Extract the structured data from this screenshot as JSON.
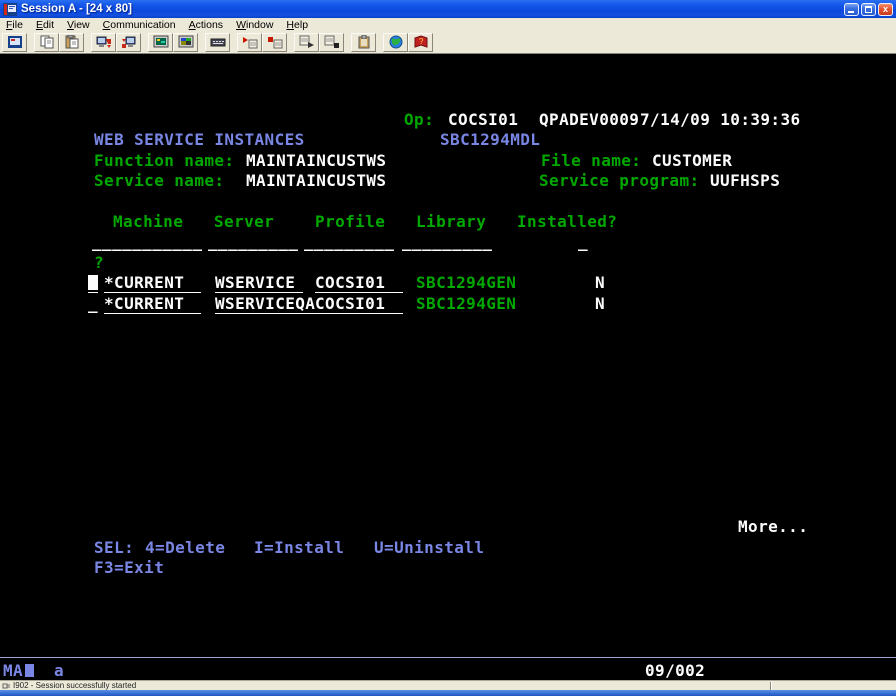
{
  "window": {
    "title": "Session A - [24 x 80]"
  },
  "menu": {
    "items": [
      {
        "accel": "F",
        "rest": "ile"
      },
      {
        "accel": "E",
        "rest": "dit"
      },
      {
        "accel": "V",
        "rest": "iew"
      },
      {
        "accel": "C",
        "rest": "ommunication"
      },
      {
        "accel": "A",
        "rest": "ctions"
      },
      {
        "accel": "W",
        "rest": "indow"
      },
      {
        "accel": "H",
        "rest": "elp"
      }
    ]
  },
  "toolbar": {
    "icons": [
      "new-session",
      "copy",
      "paste",
      "send-file",
      "receive-file",
      "display-setup",
      "color-setup",
      "keyboard-setup",
      "record-macro",
      "stop-macro",
      "play-macro",
      "step-macro",
      "clipboard",
      "web-browser",
      "help"
    ]
  },
  "terminal": {
    "colors": {
      "green": "#00a800",
      "blue": "#7a86e4",
      "white": "#fcfcfc",
      "background": "#000000"
    },
    "op_label": "Op:",
    "op_value": "COCSI01",
    "device": "QPADEV0009",
    "datetime": "7/14/09 10:39:36",
    "screen_title": "WEB SERVICE INSTANCES",
    "model": "SBC1294MDL",
    "function_label": "Function name:",
    "function_value": "MAINTAINCUSTWS",
    "file_label": "File name:",
    "file_value": "CUSTOMER",
    "service_label": "Service name:",
    "service_value": "MAINTAINCUSTWS",
    "service_program_label": "Service program:",
    "service_program_value": "UUFHSPS",
    "columns": [
      "Machine",
      "Server",
      "Profile",
      "Library",
      "Installed?"
    ],
    "underscores": {
      "c1": "___________",
      "c2": "_________",
      "c3": "_________",
      "c4": "_________",
      "c5": "_"
    },
    "prompt": "?",
    "rows": [
      {
        "sel": "",
        "machine": "*CURRENT",
        "server": "WSERVICE",
        "profile": "COCSI01",
        "library": "SBC1294GEN",
        "installed": "N"
      },
      {
        "sel": "_",
        "machine": "*CURRENT",
        "server": "WSERVICEQA",
        "profile": "COCSI01",
        "library": "SBC1294GEN",
        "installed": "N"
      }
    ],
    "more": "More...",
    "sel_label": "SEL:",
    "sel_options": [
      "4=Delete",
      "I=Install",
      "U=Uninstall"
    ],
    "fkeys": "F3=Exit",
    "oia": {
      "left": "MA",
      "keyboard_state": "a",
      "cursor_position": "09/002"
    }
  },
  "statusbar": {
    "message": "I902 - Session successfully started"
  }
}
